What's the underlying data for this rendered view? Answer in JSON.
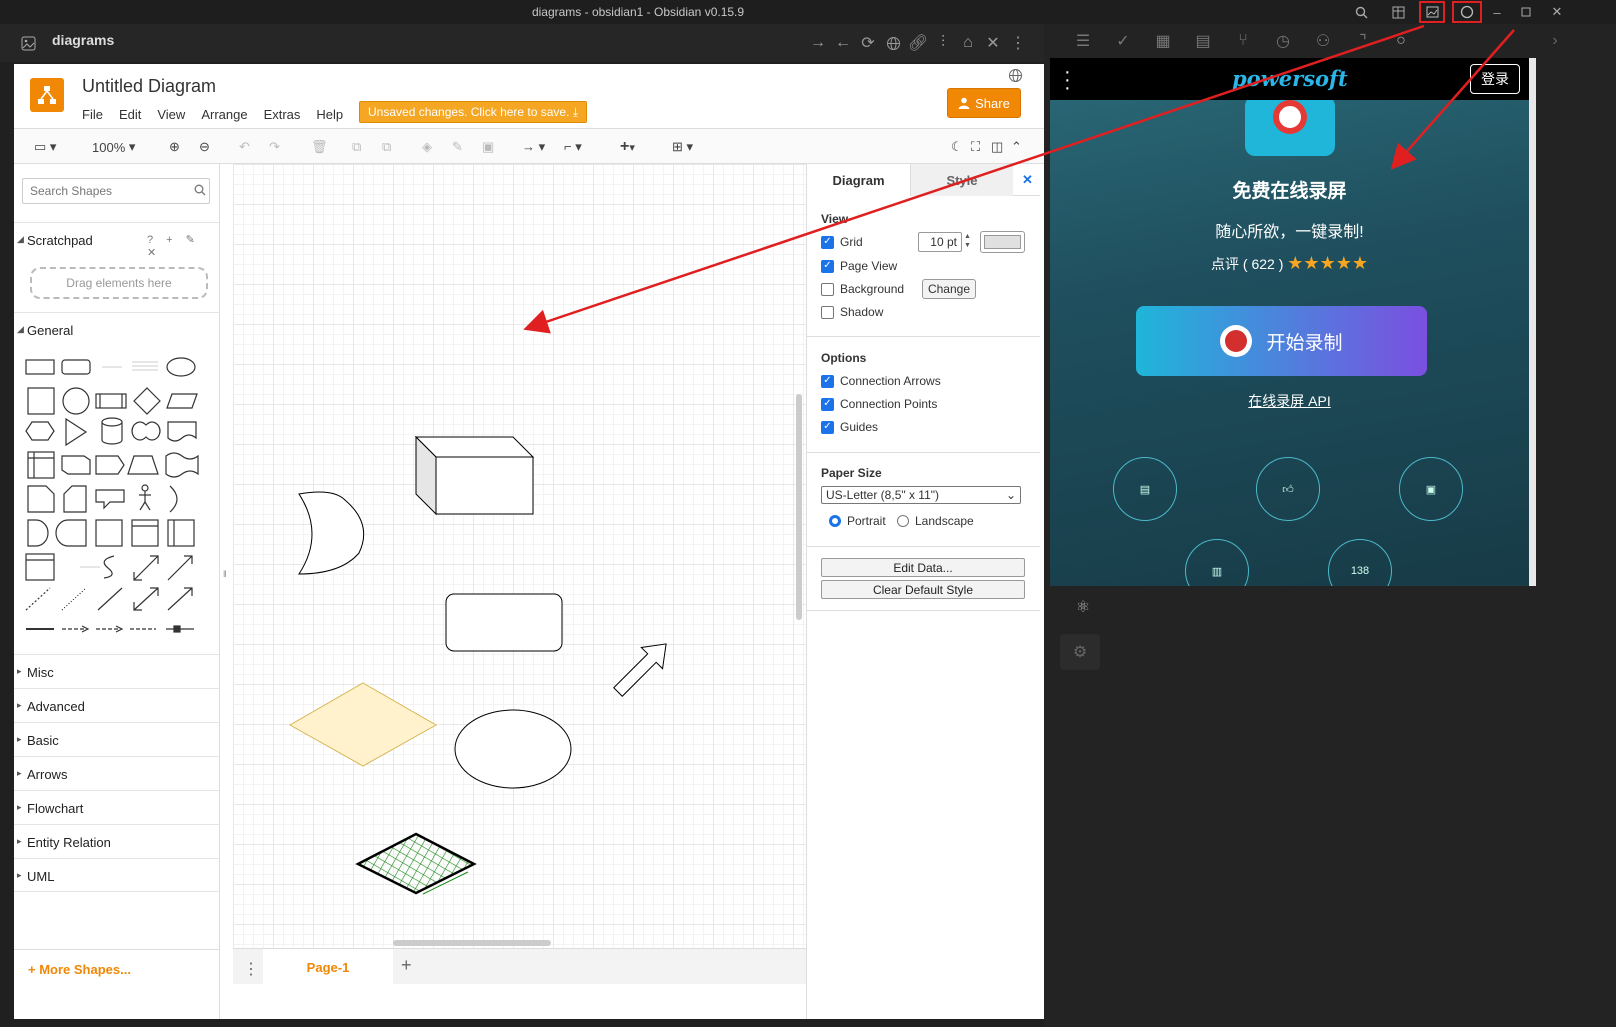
{
  "window": {
    "title": "diagrams - obsidian1 - Obsidian v0.15.9"
  },
  "tab": {
    "title": "diagrams"
  },
  "drawio": {
    "diagram_title": "Untitled Diagram",
    "menus": [
      "File",
      "Edit",
      "View",
      "Arrange",
      "Extras",
      "Help"
    ],
    "unsaved_notice": "Unsaved changes. Click here to save.",
    "share_label": "Share",
    "zoom": "100%",
    "search_placeholder": "Search Shapes",
    "scratchpad_label": "Scratchpad",
    "scratchpad_icons": "? + ✎ ✕",
    "drag_hint": "Drag elements here",
    "general_label": "General",
    "sections": [
      "Misc",
      "Advanced",
      "Basic",
      "Arrows",
      "Flowchart",
      "Entity Relation",
      "UML"
    ],
    "more_shapes": "More Shapes...",
    "page_tab": "Page-1",
    "format": {
      "tab_diagram": "Diagram",
      "tab_style": "Style",
      "view_label": "View",
      "grid_label": "Grid",
      "grid_size": "10 pt",
      "page_view_label": "Page View",
      "background_label": "Background",
      "change_button": "Change",
      "shadow_label": "Shadow",
      "options_label": "Options",
      "connection_arrows": "Connection Arrows",
      "connection_points": "Connection Points",
      "guides": "Guides",
      "paper_size_label": "Paper Size",
      "paper_size_value": "US-Letter (8,5\" x 11\")",
      "portrait": "Portrait",
      "landscape": "Landscape",
      "edit_data": "Edit Data...",
      "clear_style": "Clear Default Style"
    }
  },
  "webview": {
    "brand": "powersoft",
    "login": "登录",
    "headline": "免费在线录屏",
    "subhead": "随心所欲，一键录制!",
    "rating_text": "点评 ( 622 )",
    "rating_stars": "★★★★★",
    "record_button": "开始录制",
    "api_link": "在线录屏 API",
    "badge_count": "138"
  },
  "colors": {
    "drawio_accent": "#f08705",
    "annotation_red": "#e02020",
    "checkbox_blue": "#1a73e8"
  }
}
